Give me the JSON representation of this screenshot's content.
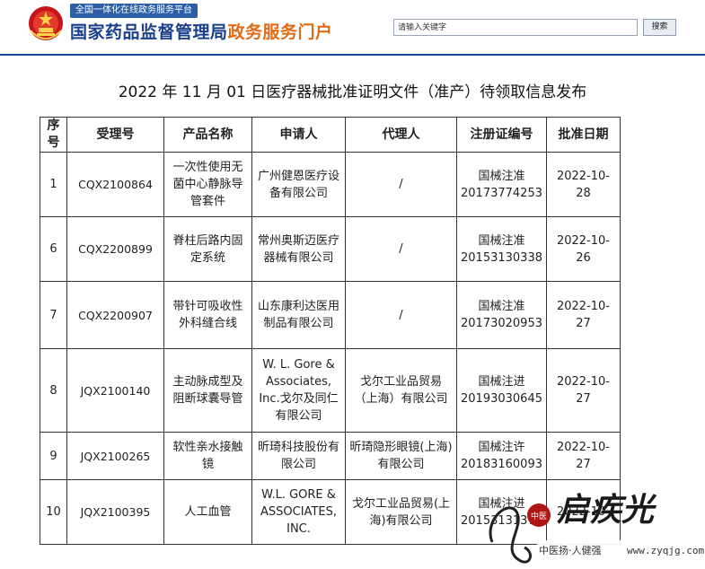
{
  "header": {
    "platform_tag": "全国一体化在线政务服务平台",
    "title_part1": "国家药品监督管理局",
    "title_part2": "政务服务门户",
    "emblem_icon": "national-emblem-icon",
    "search": {
      "placeholder": "请输入关键字",
      "button_label": "搜索"
    }
  },
  "page": {
    "title": "2022 年 11 月 01 日医疗器械批准证明文件（准产）待领取信息发布"
  },
  "table": {
    "headers": [
      "序号",
      "受理号",
      "产品名称",
      "申请人",
      "代理人",
      "注册证编号",
      "批准日期"
    ],
    "rows": [
      {
        "seq": "1",
        "acceptance_no": "CQX2100864",
        "product": "一次性使用无菌中心静脉导管套件",
        "applicant": "广州健恩医疗设备有限公司",
        "agent": "/",
        "reg_no_1": "国械注准",
        "reg_no_2": "20173774253",
        "date": "2022-10-28"
      },
      {
        "seq": "6",
        "acceptance_no": "CQX2200899",
        "product": "脊柱后路内固定系统",
        "applicant": "常州奥斯迈医疗器械有限公司",
        "agent": "/",
        "reg_no_1": "国械注准",
        "reg_no_2": "20153130338",
        "date": "2022-10-26"
      },
      {
        "seq": "7",
        "acceptance_no": "CQX2200907",
        "product": "带针可吸收性外科缝合线",
        "applicant": "山东康利达医用制品有限公司",
        "agent": "/",
        "reg_no_1": "国械注准",
        "reg_no_2": "20173020953",
        "date": "2022-10-27"
      },
      {
        "seq": "8",
        "acceptance_no": "JQX2100140",
        "product": "主动脉成型及阻断球囊导管",
        "applicant": "W. L. Gore & Associates, Inc.戈尔及同仁有限公司",
        "agent": "戈尔工业品贸易（上海）有限公司",
        "reg_no_1": "国械注进",
        "reg_no_2": "20193030645",
        "date": "2022-10-27"
      },
      {
        "seq": "9",
        "acceptance_no": "JQX2100265",
        "product": "软性亲水接触镜",
        "applicant": "昕琦科技股份有限公司",
        "agent": "昕琦隐形眼镜(上海)有限公司",
        "reg_no_1": "国械注许",
        "reg_no_2": "20183160093",
        "date": "2022-10-27"
      },
      {
        "seq": "10",
        "acceptance_no": "JQX2100395",
        "product": "人工血管",
        "applicant": "W.L. GORE & ASSOCIATES, INC.",
        "agent": "戈尔工业品贸易(上海)有限公司",
        "reg_no_1": "国械注进",
        "reg_no_2": "20153131372",
        "date": "2022-10-"
      }
    ]
  },
  "watermark": {
    "brand": "启疾光",
    "tagline": "中医扬·人健强",
    "url": "www.zyqjg.com",
    "seal_text": "中医"
  },
  "colors": {
    "brand_blue": "#1a3f8b",
    "brand_orange": "#e06a16",
    "platform_tag_bg": "#2d5fa8",
    "watermark_red": "#b01515"
  }
}
